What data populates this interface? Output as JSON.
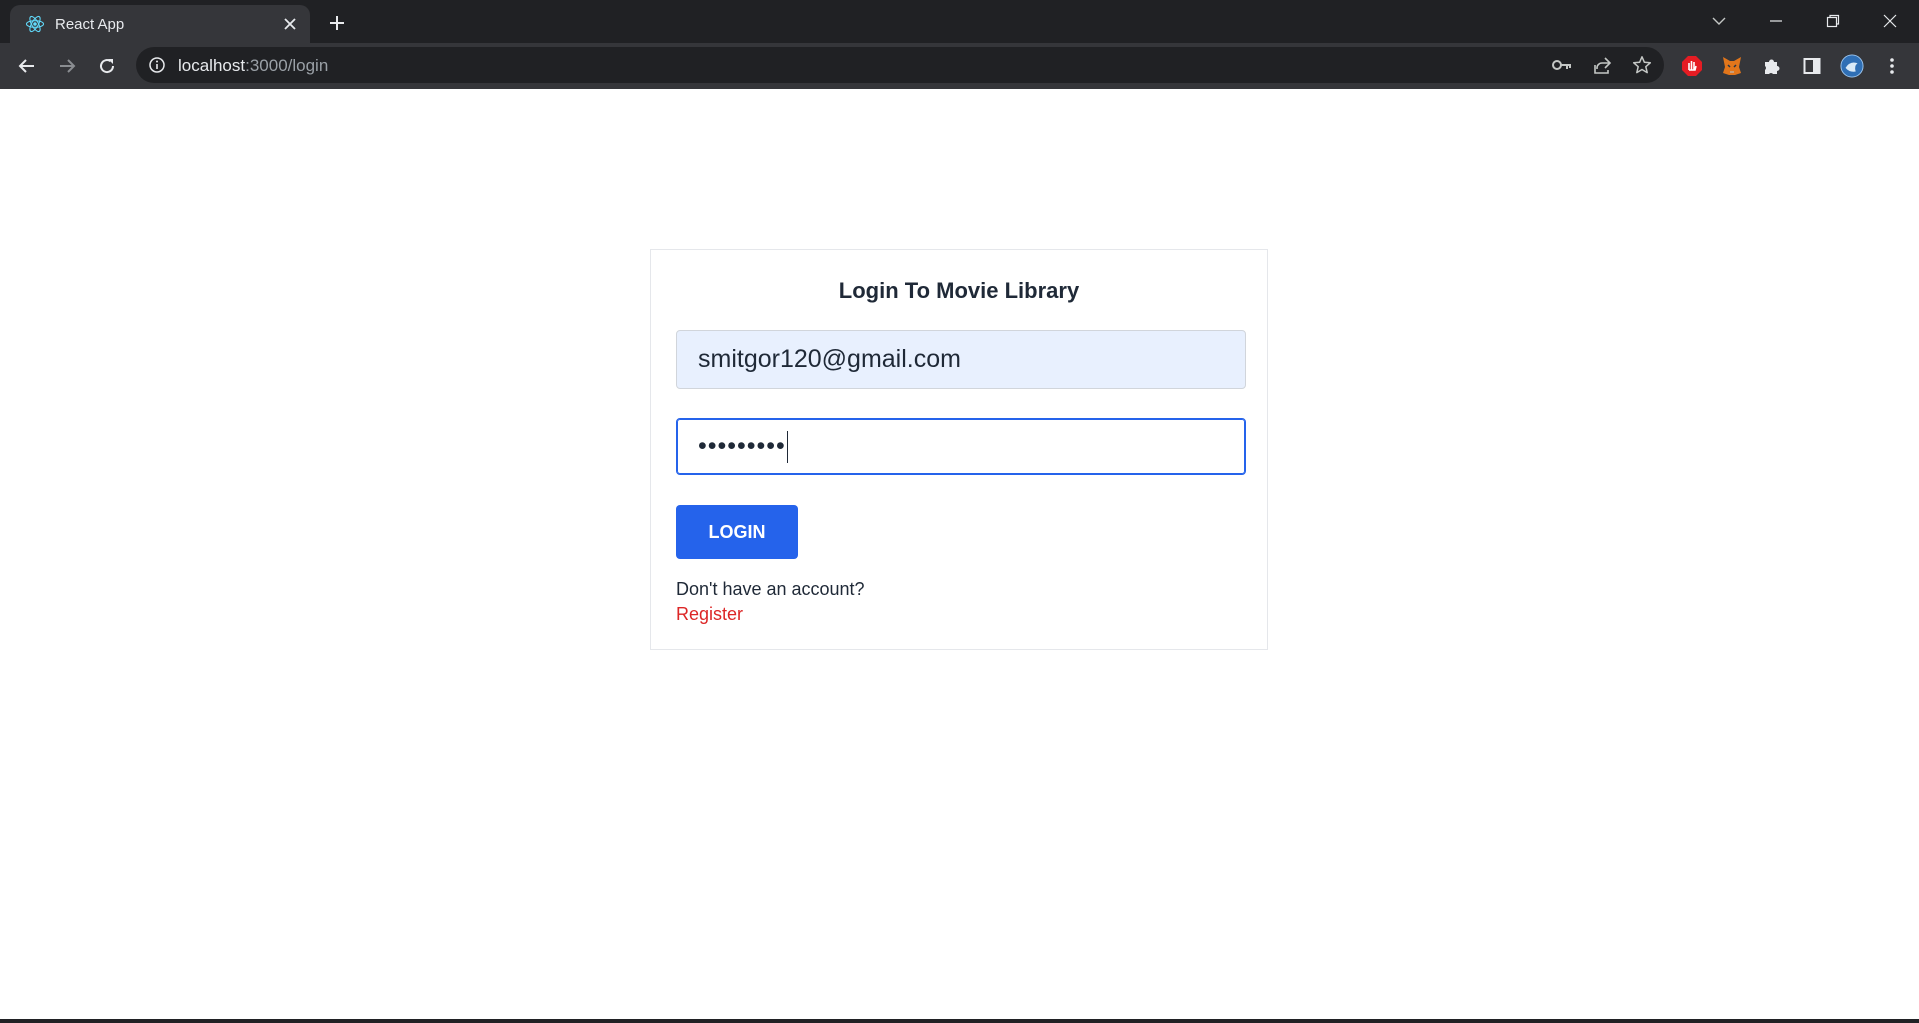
{
  "browser": {
    "tab_title": "React App",
    "url_host": "localhost",
    "url_path": ":3000/login"
  },
  "login": {
    "heading": "Login To Movie Library",
    "email_value": "smitgor120@gmail.com",
    "password_masked": "•••••••••",
    "button_label": "LOGIN",
    "prompt_text": "Don't have an account?",
    "register_link": "Register"
  },
  "colors": {
    "primary": "#2563eb",
    "link": "#dc2626",
    "autofill_bg": "#e8f0fe",
    "chrome_dark": "#202124",
    "chrome_toolbar": "#35363a"
  },
  "icons": [
    "react-logo-icon",
    "close-icon",
    "plus-icon",
    "chevron-down-icon",
    "minimize-icon",
    "restore-icon",
    "window-close-icon",
    "back-arrow-icon",
    "forward-arrow-icon",
    "reload-icon",
    "info-icon",
    "key-icon",
    "share-icon",
    "star-icon",
    "adblock-icon",
    "metamask-icon",
    "puzzle-icon",
    "side-panel-icon",
    "profile-avatar-icon",
    "kebab-menu-icon"
  ]
}
